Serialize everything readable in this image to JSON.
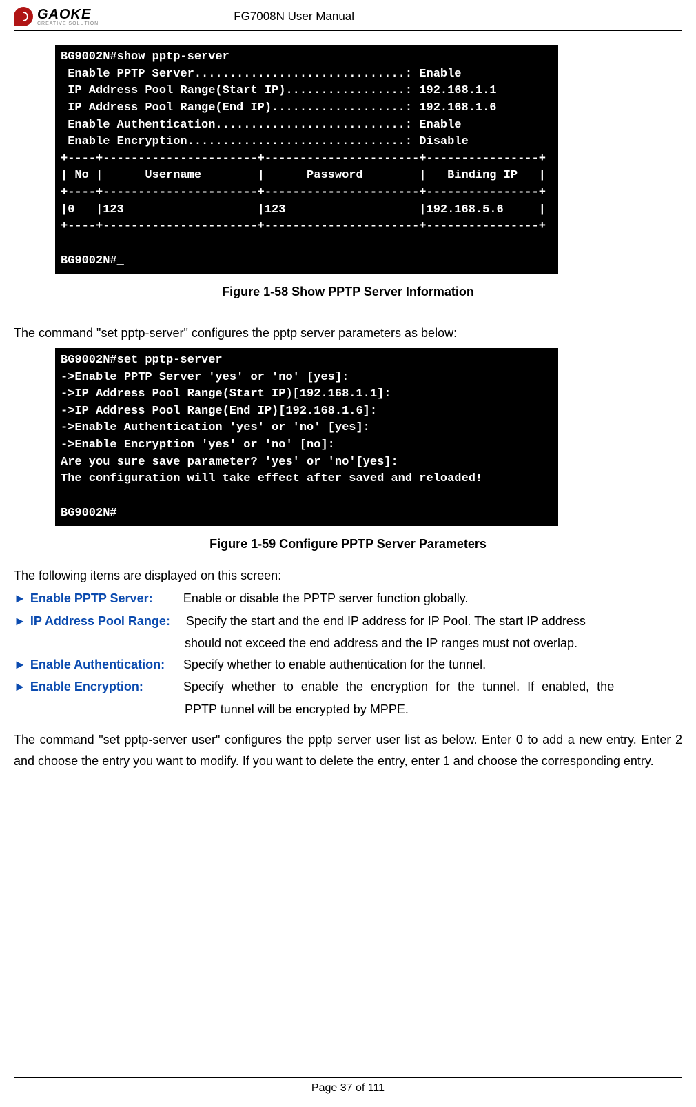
{
  "header": {
    "logo_name": "GAOKE",
    "logo_sub": "CREATIVE SOLUTION",
    "doc_title": "FG7008N User Manual"
  },
  "terminal1": "BG9002N#show pptp-server\n Enable PPTP Server..............................: Enable\n IP Address Pool Range(Start IP).................: 192.168.1.1\n IP Address Pool Range(End IP)...................: 192.168.1.6\n Enable Authentication...........................: Enable\n Enable Encryption...............................: Disable\n+----+----------------------+----------------------+----------------+\n| No |      Username        |      Password        |   Binding IP   |\n+----+----------------------+----------------------+----------------+\n|0   |123                   |123                   |192.168.5.6     |\n+----+----------------------+----------------------+----------------+\n\nBG9002N#_",
  "caption1": "Figure 1-58    Show PPTP Server Information",
  "intro2": "The command \"set pptp-server\" configures the pptp server parameters as below:",
  "terminal2": "BG9002N#set pptp-server\n->Enable PPTP Server 'yes' or 'no' [yes]:\n->IP Address Pool Range(Start IP)[192.168.1.1]:\n->IP Address Pool Range(End IP)[192.168.1.6]:\n->Enable Authentication 'yes' or 'no' [yes]:\n->Enable Encryption 'yes' or 'no' [no]:\nAre you sure save parameter? 'yes' or 'no'[yes]:\nThe configuration will take effect after saved and reloaded!\n\nBG9002N#",
  "caption2": "Figure 1-59    Configure PPTP Server Parameters",
  "items_intro": "The following items are displayed on this screen:",
  "defs": {
    "d1_label": "Enable PPTP Server:",
    "d1_value": "Enable or disable the PPTP server function globally.",
    "d2_label": "IP Address Pool Range:",
    "d2_value_a": "Specify the start and the end IP address for IP Pool. The start IP address",
    "d2_value_b": "should not exceed the end address and the IP ranges must not overlap.",
    "d3_label": "Enable Authentication:",
    "d3_value": "Specify whether to enable authentication for the tunnel.",
    "d4_label": "Enable  Encryption:",
    "d4_value_a": "Specify whether to enable the encryption for the tunnel. If enabled, the",
    "d4_value_b": "PPTP tunnel will be encrypted by MPPE."
  },
  "para2": "The command \"set pptp-server user\" configures the pptp server user list as below. Enter 0 to add a new entry. Enter 2 and choose the entry you want to modify. If you want to delete the entry, enter 1 and choose the corresponding entry.",
  "footer": "Page 37 of 111"
}
